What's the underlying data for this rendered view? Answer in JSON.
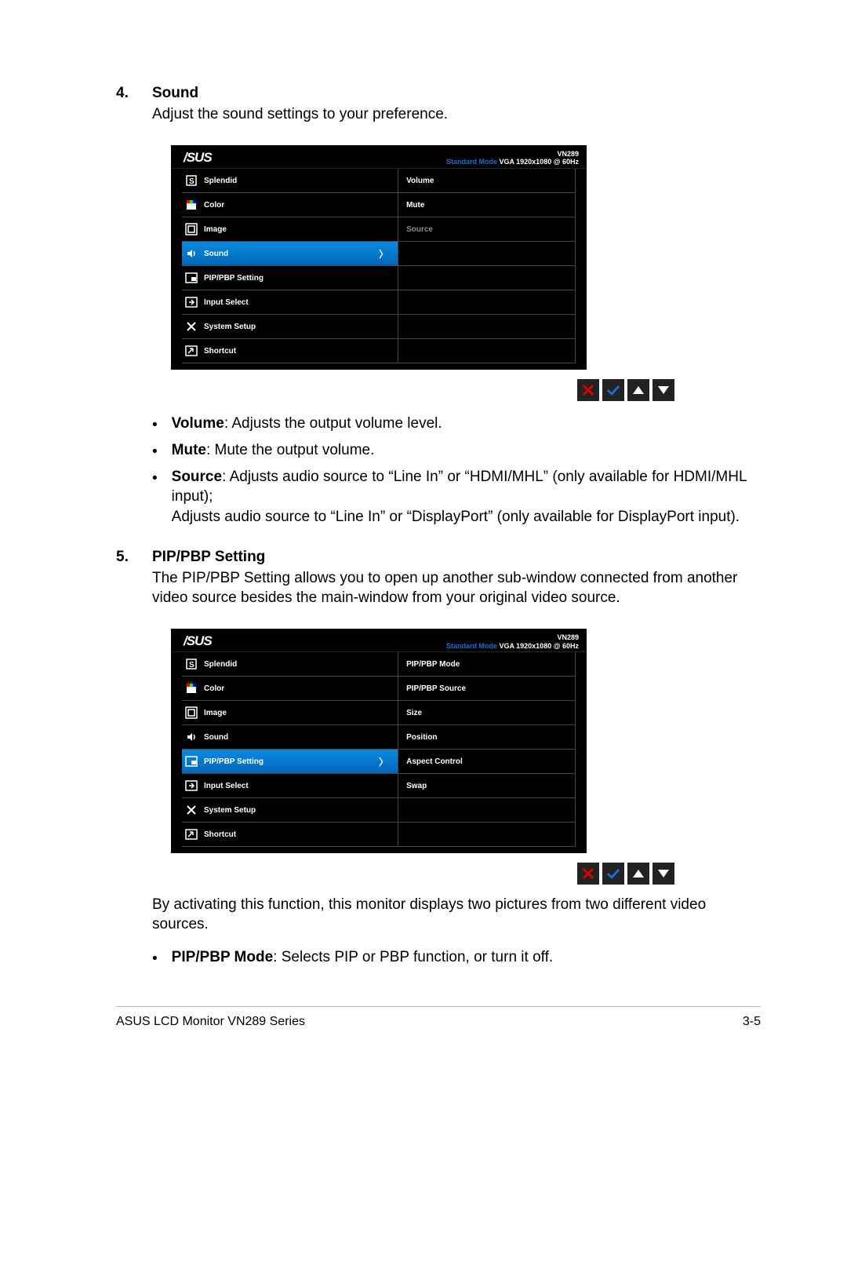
{
  "sections": [
    {
      "num": "4.",
      "title": "Sound",
      "intro": "Adjust the sound settings to your preference."
    },
    {
      "num": "5.",
      "title": "PIP/PBP Setting",
      "intro": "The PIP/PBP Setting allows you to open up another sub-window connected from another video source besides the main-window from your original video source."
    }
  ],
  "osd_header": {
    "brand": "/SUS",
    "model": "VN289",
    "mode": "Standard Mode",
    "res": "VGA  1920x1080 @ 60Hz"
  },
  "menu_main": [
    "Splendid",
    "Color",
    "Image",
    "Sound",
    "PIP/PBP Setting",
    "Input Select",
    "System Setup",
    "Shortcut"
  ],
  "sound_sub": [
    "Volume",
    "Mute",
    "Source",
    "",
    "",
    "",
    "",
    ""
  ],
  "pip_sub": [
    "PIP/PBP Mode",
    "PIP/PBP Source",
    "Size",
    "Position",
    "Aspect Control",
    "Swap",
    "",
    ""
  ],
  "bullets_sound": [
    {
      "term": "Volume",
      "text": ": Adjusts the output volume level."
    },
    {
      "term": "Mute",
      "text": ": Mute the output volume."
    },
    {
      "term": "Source",
      "text": ": Adjusts audio source to “Line In” or “HDMI/MHL”  (only available for HDMI/MHL input);",
      "cont": "Adjusts audio source to “Line In” or “DisplayPort” (only available for DisplayPort input)."
    }
  ],
  "after_pip": "By activating this function, this monitor displays two pictures from two different video sources.",
  "bullets_pip": [
    {
      "term": "PIP/PBP Mode",
      "text": ": Selects PIP or PBP function, or turn it off."
    }
  ],
  "footer": {
    "left": "ASUS LCD Monitor VN289 Series",
    "right": "3-5"
  }
}
